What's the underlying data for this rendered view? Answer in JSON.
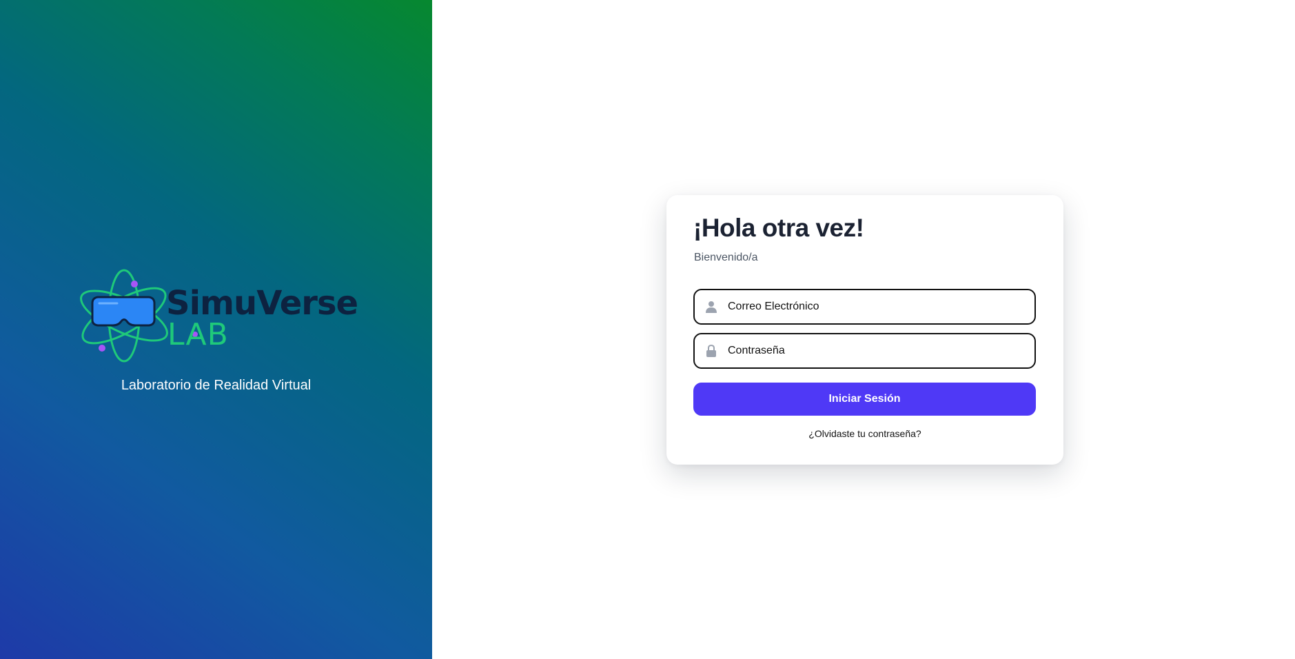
{
  "brand": {
    "name": "SimuVerse",
    "suffix": "LAB",
    "tagline": "Laboratorio de Realidad Virtual",
    "colors": {
      "wordmark": "#0d2240",
      "suffix": "#1fc97a",
      "orbit": "#1fc97a",
      "headset": "#2b86f5",
      "electron": "#a855f7",
      "gradient_start": "#1e3aa8",
      "gradient_end": "#06882f"
    },
    "logo_icons": [
      "atom-orbit-icon",
      "vr-headset-icon"
    ]
  },
  "login": {
    "title": "¡Hola otra vez!",
    "subtitle": "Bienvenido/a",
    "email": {
      "placeholder": "Correo Electrónico",
      "value": "",
      "icon": "user-icon"
    },
    "password": {
      "placeholder": "Contraseña",
      "value": "",
      "icon": "lock-icon"
    },
    "submit_label": "Iniciar Sesión",
    "forgot_label": "¿Olvidaste tu contraseña?",
    "colors": {
      "primary": "#4f39f6",
      "title": "#1b2232",
      "icon": "#9ca3af"
    }
  }
}
